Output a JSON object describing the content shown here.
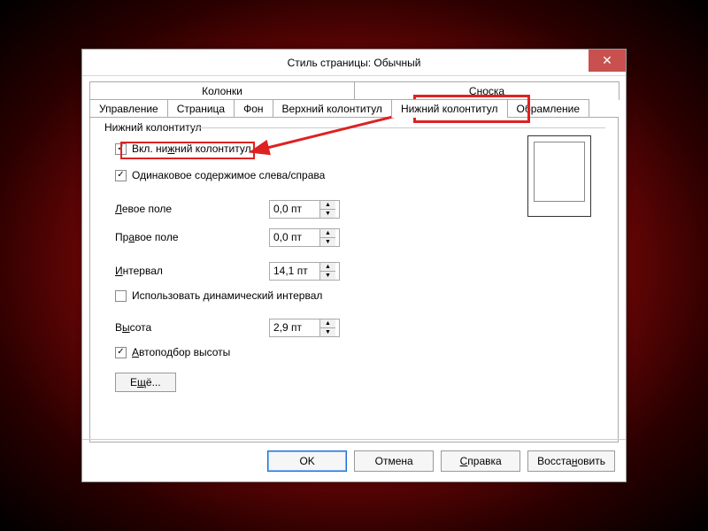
{
  "title": "Стиль страницы: Обычный",
  "tabs_top": [
    "Колонки",
    "Сноска"
  ],
  "tabs_bottom": [
    "Управление",
    "Страница",
    "Фон",
    "Верхний колонтитул",
    "Нижний колонтитул",
    "Обрамление"
  ],
  "active_tab": "Нижний колонтитул",
  "group": {
    "title": "Нижний колонтитул",
    "enable": {
      "label": "Вкл. нижний колонтитул",
      "checked": true
    },
    "same_lr": {
      "label": "Одинаковое содержимое слева/справа",
      "checked": true
    },
    "left_margin": {
      "label": "Левое поле",
      "value": "0,0 пт"
    },
    "right_margin": {
      "label": "Правое поле",
      "value": "0,0 пт"
    },
    "spacing": {
      "label": "Интервал",
      "value": "14,1 пт"
    },
    "dynamic_spacing": {
      "label": "Использовать динамический интервал",
      "checked": false
    },
    "height": {
      "label": "Высота",
      "value": "2,9 пт"
    },
    "autofit": {
      "label": "Автоподбор высоты",
      "checked": true
    },
    "more_btn": "Ещё..."
  },
  "buttons": {
    "ok": "OK",
    "cancel": "Отмена",
    "help": "Справка",
    "reset": "Восстановить"
  }
}
